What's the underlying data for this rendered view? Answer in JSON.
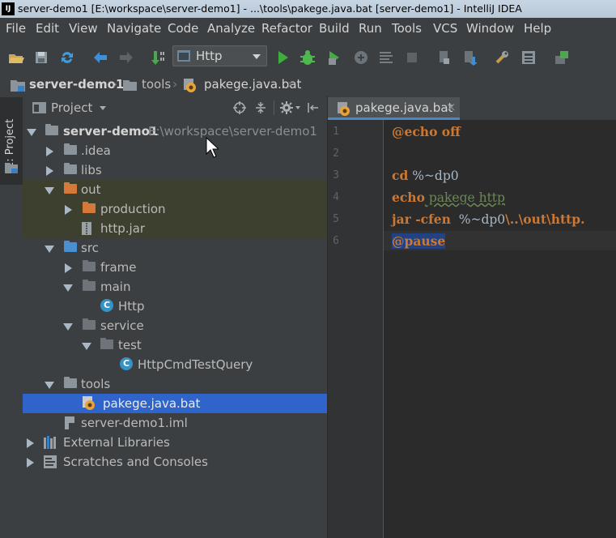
{
  "window": {
    "title": "server-demo1 [E:\\workspace\\server-demo1] - ...\\tools\\pakege.java.bat [server-demo1] - IntelliJ IDEA",
    "app_badge": "IJ"
  },
  "menu": [
    "File",
    "Edit",
    "View",
    "Navigate",
    "Code",
    "Analyze",
    "Refactor",
    "Build",
    "Run",
    "Tools",
    "VCS",
    "Window",
    "Help"
  ],
  "toolbar": {
    "run_config": "Http"
  },
  "breadcrumb": [
    "server-demo1",
    "tools",
    "pakege.java.bat"
  ],
  "side_strip": {
    "project_tab": "1: Project"
  },
  "project_panel": {
    "title": "Project",
    "tree": [
      {
        "label": "server-demo1",
        "path": "E:\\workspace\\server-demo1"
      },
      {
        "label": ".idea"
      },
      {
        "label": "libs"
      },
      {
        "label": "out"
      },
      {
        "label": "production"
      },
      {
        "label": "http.jar"
      },
      {
        "label": "src"
      },
      {
        "label": "frame"
      },
      {
        "label": "main"
      },
      {
        "label": "Http"
      },
      {
        "label": "service"
      },
      {
        "label": "test"
      },
      {
        "label": "HttpCmdTestQuery"
      },
      {
        "label": "tools"
      },
      {
        "label": "pakege.java.bat"
      },
      {
        "label": "server-demo1.iml"
      },
      {
        "label": "External Libraries"
      },
      {
        "label": "Scratches and Consoles"
      }
    ]
  },
  "editor": {
    "tab_label": "pakege.java.bat",
    "line_numbers": [
      "1",
      "2",
      "3",
      "4",
      "5",
      "6"
    ],
    "code": {
      "l1_kw": "@echo off",
      "l3_kw": "cd",
      "l3_rest": " %~dp0",
      "l4_kw": "echo",
      "l4_rest": " pakege http",
      "l5_kw": "jar -cfen",
      "l5_rest": "  %~dp0",
      "l5_tail": "\\..\\out\\http.",
      "l6_kw": "@pause"
    }
  },
  "colors": {
    "selection": "#2f65ca",
    "excluded_bg": "#3d3f2f",
    "keyword": "#cc7832"
  }
}
